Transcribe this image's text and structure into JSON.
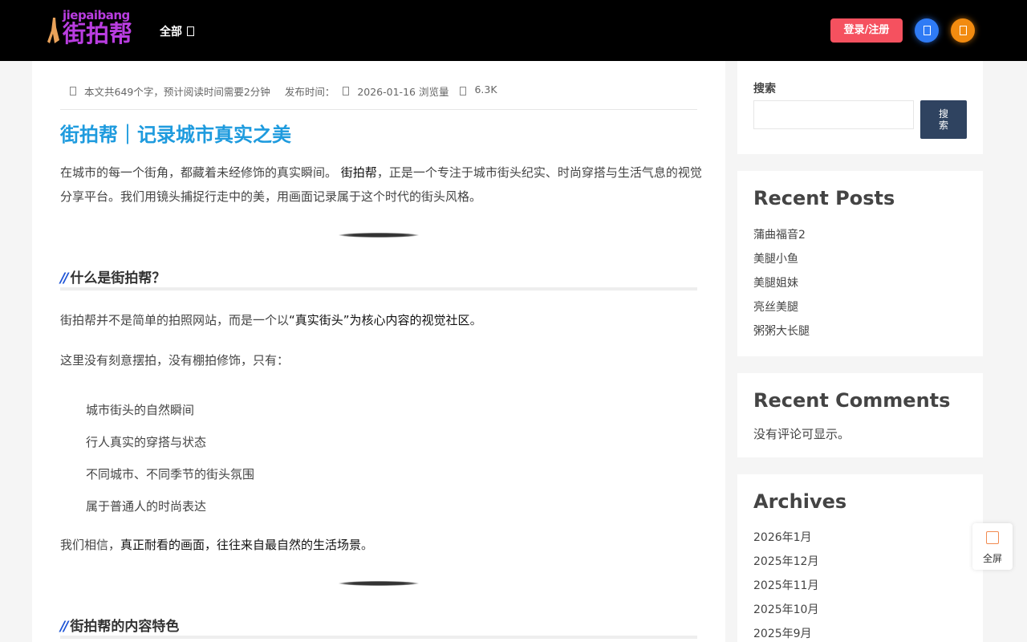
{
  "header": {
    "logo_en": "jiepaibang",
    "logo_cn": "街拍帮",
    "nav_all": "全部",
    "login_button": "登录/注册",
    "icon_blue": "theme-icon",
    "icon_orange": "user-icon"
  },
  "article": {
    "meta_wordcount": "本文共649个字，预计阅读时间需要2分钟",
    "meta_published_label": "发布时间：",
    "meta_date": "2026-01-16 浏览量",
    "meta_views": "6.3K",
    "title": "街拍帮｜记录城市真实之美",
    "intro_part1": "在城市的每一个街角，都藏着未经修饰的真实瞬间。",
    "intro_bold": "街拍帮",
    "intro_part2": "，正是一个专注于城市街头纪实、时尚穿搭与生活气息的视觉分享平台。我们用镜头捕捉行走中的美，用画面记录属于这个时代的街头风格。",
    "section1_title": "什么是街拍帮？",
    "section1_p1_part1": "街拍帮并不是简单的拍照网站，而是一个以",
    "section1_p1_bold": "“真实街头”为核心内容的视觉社区",
    "section1_p1_part2": "。",
    "section1_p2": "这里没有刻意摆拍，没有棚拍修饰，只有：",
    "list": [
      "城市街头的自然瞬间",
      "行人真实的穿搭与状态",
      "不同城市、不同季节的街头氛围",
      "属于普通人的时尚表达"
    ],
    "section1_p3_part1": "我们相信，",
    "section1_p3_bold": "真正耐看的画面，往往来自最自然的生活场景",
    "section1_p3_part2": "。",
    "section2_title": "街拍帮的内容特色"
  },
  "sidebar": {
    "search_label": "搜索",
    "search_placeholder": "",
    "search_button": "搜索",
    "recent_posts_title": "Recent Posts",
    "recent_posts": [
      "蒲曲福音2",
      "美腿小鱼",
      "美腿姐妹",
      "亮丝美腿",
      "粥粥大长腿"
    ],
    "recent_comments_title": "Recent Comments",
    "recent_comments_empty": "没有评论可显示。",
    "archives_title": "Archives",
    "archives": [
      "2026年1月",
      "2025年12月",
      "2025年11月",
      "2025年10月",
      "2025年9月"
    ]
  },
  "fullscreen": {
    "label": "全屏",
    "icon": "fullscreen-icon"
  },
  "colors": {
    "accent_blue": "#1e9bde",
    "login_red": "#f5515f",
    "logo_purple": "#b93de0",
    "search_btn": "#2f4360"
  }
}
